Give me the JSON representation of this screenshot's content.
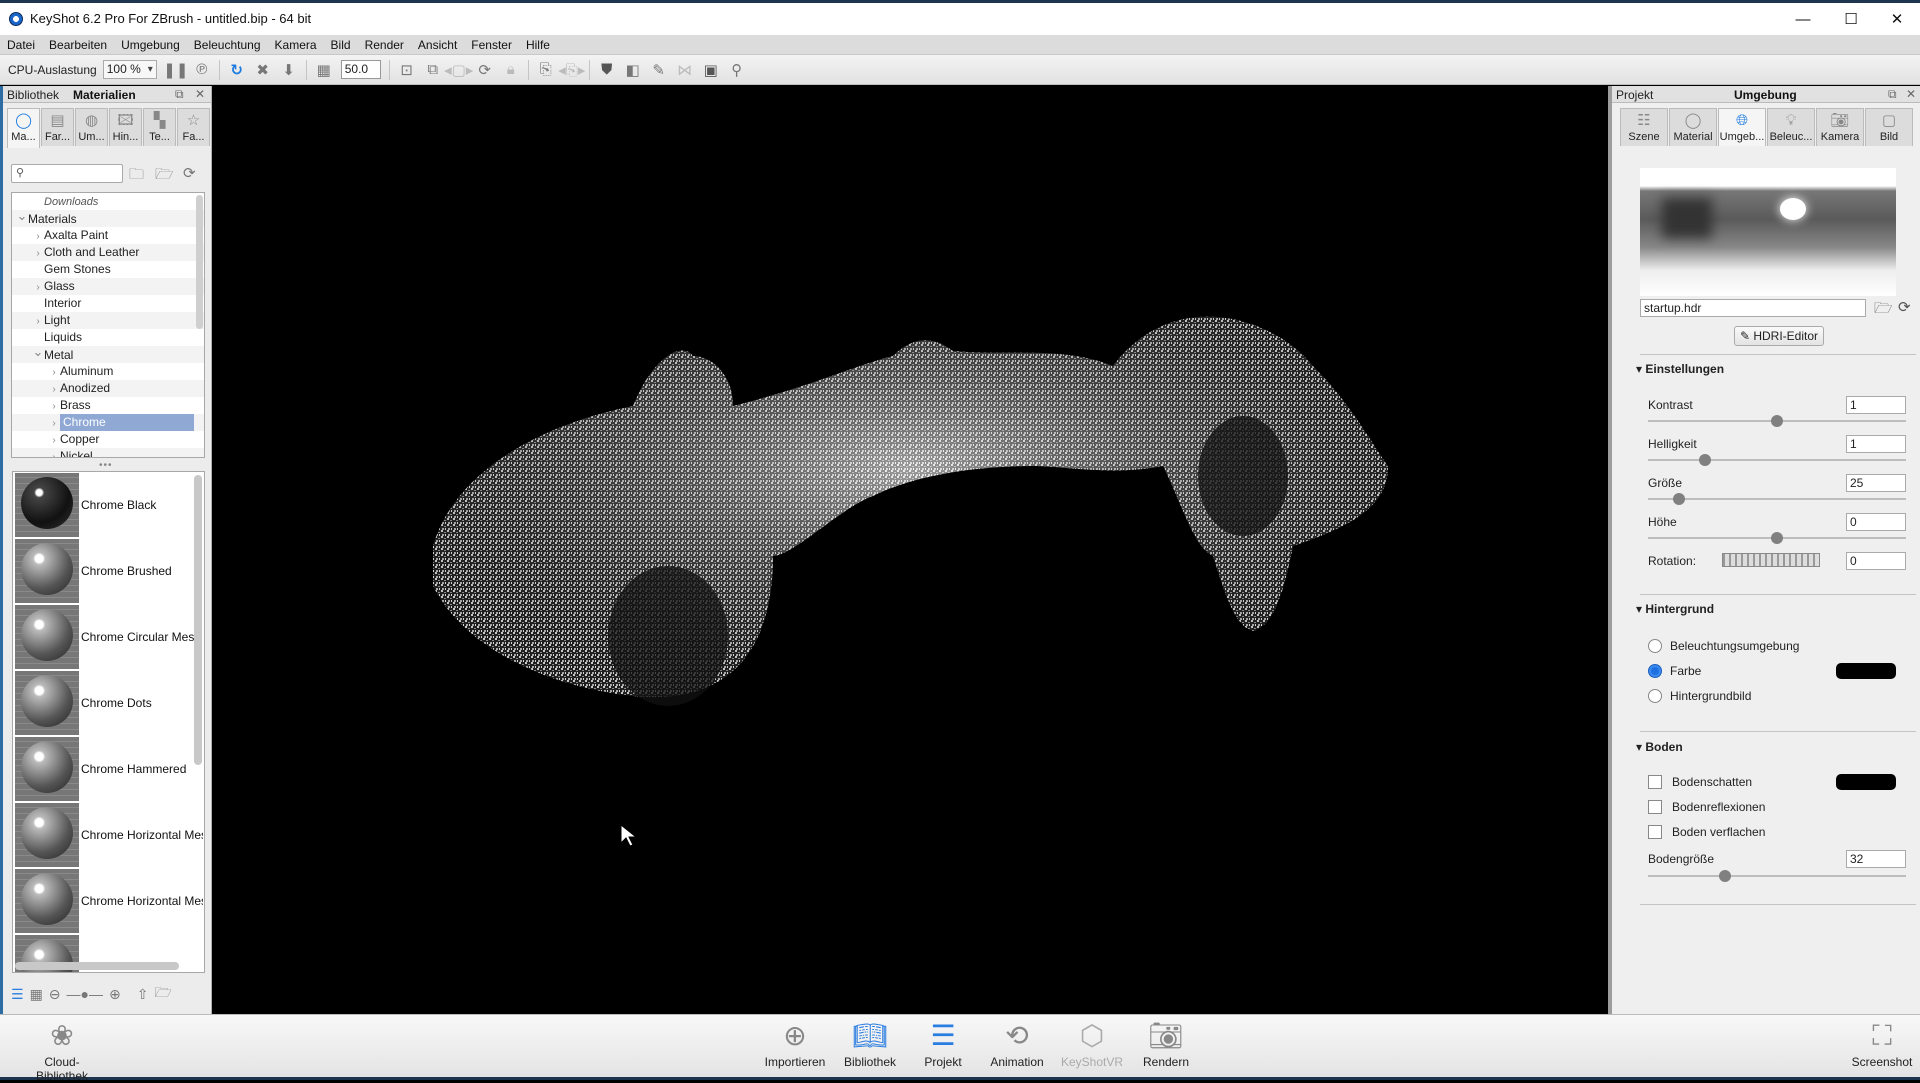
{
  "window": {
    "title": "KeyShot 6.2 Pro For ZBrush - untitled.bip  - 64 bit",
    "controls": {
      "minimize": "—",
      "maximize": "☐",
      "close": "✕"
    }
  },
  "menu": [
    "Datei",
    "Bearbeiten",
    "Umgebung",
    "Beleuchtung",
    "Kamera",
    "Bild",
    "Render",
    "Ansicht",
    "Fenster",
    "Hilfe"
  ],
  "toolbar": {
    "cpu_label": "CPU-Auslastung",
    "cpu_value": "100 %",
    "fov_value": "50.0",
    "icons": [
      "pause-icon",
      "performance-mode-icon",
      "refresh-icon",
      "fit-view-icon",
      "drop-to-ground-icon",
      "grid-icon",
      "add-camera-icon",
      "camera-list-icon",
      "prev-camera-icon",
      "reset-camera-icon",
      "lock-camera-icon",
      "add-studio-icon",
      "prev-studio-icon",
      "geometry-shield-icon",
      "layout-icon",
      "paint-icon",
      "network-icon",
      "terminal-icon",
      "zbrush-icon"
    ]
  },
  "left_panel": {
    "header_left": "Bibliothek",
    "header_title": "Materialien",
    "tabs": [
      {
        "label": "Ma...",
        "icon": "material-icon",
        "active": true
      },
      {
        "label": "Far...",
        "icon": "colors-icon",
        "active": false
      },
      {
        "label": "Um...",
        "icon": "environment-icon",
        "active": false
      },
      {
        "label": "Hin...",
        "icon": "backplate-icon",
        "active": false
      },
      {
        "label": "Te...",
        "icon": "texture-icon",
        "active": false
      },
      {
        "label": "Fa...",
        "icon": "favorites-icon",
        "active": false
      }
    ],
    "search_placeholder": "",
    "tree": [
      {
        "label": "Downloads",
        "level": 1,
        "italic": true,
        "chevron": ""
      },
      {
        "label": "Materials",
        "level": 0,
        "chevron": "expanded"
      },
      {
        "label": "Axalta Paint",
        "level": 1,
        "chevron": "collapsed"
      },
      {
        "label": "Cloth and Leather",
        "level": 1,
        "chevron": "collapsed"
      },
      {
        "label": "Gem Stones",
        "level": 1,
        "chevron": ""
      },
      {
        "label": "Glass",
        "level": 1,
        "chevron": "collapsed"
      },
      {
        "label": "Interior",
        "level": 1,
        "chevron": ""
      },
      {
        "label": "Light",
        "level": 1,
        "chevron": "collapsed"
      },
      {
        "label": "Liquids",
        "level": 1,
        "chevron": ""
      },
      {
        "label": "Metal",
        "level": 1,
        "chevron": "expanded"
      },
      {
        "label": "Aluminum",
        "level": 2,
        "chevron": "collapsed"
      },
      {
        "label": "Anodized",
        "level": 2,
        "chevron": "collapsed"
      },
      {
        "label": "Brass",
        "level": 2,
        "chevron": "collapsed"
      },
      {
        "label": "Chrome",
        "level": 2,
        "chevron": "collapsed",
        "selected": true
      },
      {
        "label": "Copper",
        "level": 2,
        "chevron": "collapsed"
      },
      {
        "label": "Nickel",
        "level": 2,
        "chevron": "collapsed"
      }
    ],
    "materials": [
      {
        "name": "Chrome Black",
        "dark": true
      },
      {
        "name": "Chrome Brushed",
        "dark": false
      },
      {
        "name": "Chrome Circular Mesh",
        "dark": false
      },
      {
        "name": "Chrome Dots",
        "dark": false
      },
      {
        "name": "Chrome Hammered",
        "dark": false
      },
      {
        "name": "Chrome Horizontal Mesh",
        "dark": false
      },
      {
        "name": "Chrome Horizontal Mesh",
        "dark": false
      },
      {
        "name": "",
        "dark": false
      }
    ]
  },
  "right_panel": {
    "header_left": "Projekt",
    "header_title": "Umgebung",
    "tabs": [
      {
        "label": "Szene",
        "icon": "scene-list-icon",
        "active": false
      },
      {
        "label": "Material",
        "icon": "material-icon",
        "active": false
      },
      {
        "label": "Umgeb...",
        "icon": "globe-icon",
        "active": true
      },
      {
        "label": "Beleuc...",
        "icon": "lightbulb-icon",
        "active": false
      },
      {
        "label": "Kamera",
        "icon": "camera-icon",
        "active": false
      },
      {
        "label": "Bild",
        "icon": "image-frame-icon",
        "active": false
      }
    ],
    "hdr_file": "startup.hdr",
    "hdri_editor": "HDRI-Editor",
    "settings": {
      "title": "Einstellungen",
      "kontrast": {
        "label": "Kontrast",
        "value": "1",
        "slider": 0.5
      },
      "helligkeit": {
        "label": "Helligkeit",
        "value": "1",
        "slider": 0.22
      },
      "groesse": {
        "label": "Größe",
        "value": "25",
        "slider": 0.12
      },
      "hoehe": {
        "label": "Höhe",
        "value": "0",
        "slider": 0.5
      },
      "rotation": {
        "label": "Rotation:",
        "value": "0"
      }
    },
    "background": {
      "title": "Hintergrund",
      "options": [
        {
          "label": "Beleuchtungsumgebung",
          "selected": false
        },
        {
          "label": "Farbe",
          "selected": true
        },
        {
          "label": "Hintergrundbild",
          "selected": false
        }
      ],
      "color": "#000000"
    },
    "ground": {
      "title": "Boden",
      "checks": [
        {
          "label": "Bodenschatten",
          "checked": false
        },
        {
          "label": "Bodenreflexionen",
          "checked": false
        },
        {
          "label": "Boden verflachen",
          "checked": false
        }
      ],
      "shadow_color": "#000000",
      "size": {
        "label": "Bodengröße",
        "value": "32",
        "slider": 0.3
      }
    }
  },
  "bottom_bar": {
    "cloud": "Cloud-Bibliothek",
    "buttons": [
      {
        "label": "Importieren",
        "icon": "import-icon",
        "state": "normal"
      },
      {
        "label": "Bibliothek",
        "icon": "book-icon",
        "state": "active"
      },
      {
        "label": "Projekt",
        "icon": "project-list-icon",
        "state": "active"
      },
      {
        "label": "Animation",
        "icon": "animation-play-icon",
        "state": "normal"
      },
      {
        "label": "KeyShotVR",
        "icon": "keyshotvr-icon",
        "state": "disabled"
      },
      {
        "label": "Rendern",
        "icon": "render-camera-icon",
        "state": "normal"
      }
    ],
    "screenshot": "Screenshot"
  }
}
